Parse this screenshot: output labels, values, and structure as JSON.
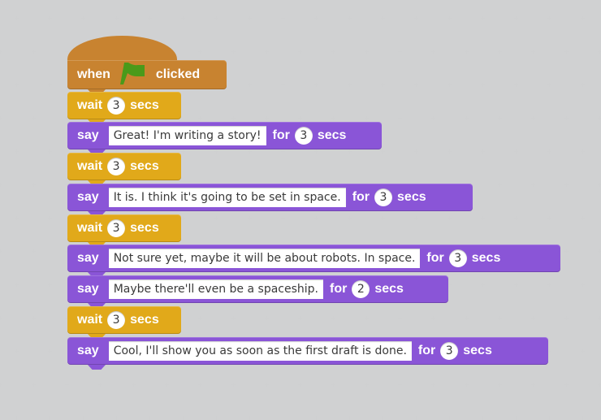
{
  "colors": {
    "background": "#dcddde",
    "events": "#c88330",
    "control": "#e1a91a",
    "looks": "#8a55d7",
    "flag": "#4a9a1a"
  },
  "hat": {
    "when_label": "when",
    "icon": "green-flag-icon",
    "clicked_label": "clicked"
  },
  "blocks": [
    {
      "type": "wait",
      "label": "wait",
      "value": "3",
      "unit": "secs"
    },
    {
      "type": "say",
      "label": "say",
      "text": "Great! I'm writing a story!",
      "for_label": "for",
      "value": "3",
      "unit": "secs"
    },
    {
      "type": "wait",
      "label": "wait",
      "value": "3",
      "unit": "secs"
    },
    {
      "type": "say",
      "label": "say",
      "text": "It is. I think it's going to be set in space.",
      "for_label": "for",
      "value": "3",
      "unit": "secs"
    },
    {
      "type": "wait",
      "label": "wait",
      "value": "3",
      "unit": "secs"
    },
    {
      "type": "say",
      "label": "say",
      "text": "Not sure yet, maybe it will be about robots. In space. ",
      "for_label": "for",
      "value": "3",
      "unit": "secs"
    },
    {
      "type": "say",
      "label": "say",
      "text": "Maybe there'll even be a spaceship. ",
      "for_label": "for",
      "value": "2",
      "unit": "secs"
    },
    {
      "type": "wait",
      "label": "wait",
      "value": "3",
      "unit": "secs"
    },
    {
      "type": "say",
      "label": "say",
      "text": "Cool, I'll show you as soon as the first draft is done.",
      "for_label": "for",
      "value": "3",
      "unit": "secs"
    }
  ]
}
